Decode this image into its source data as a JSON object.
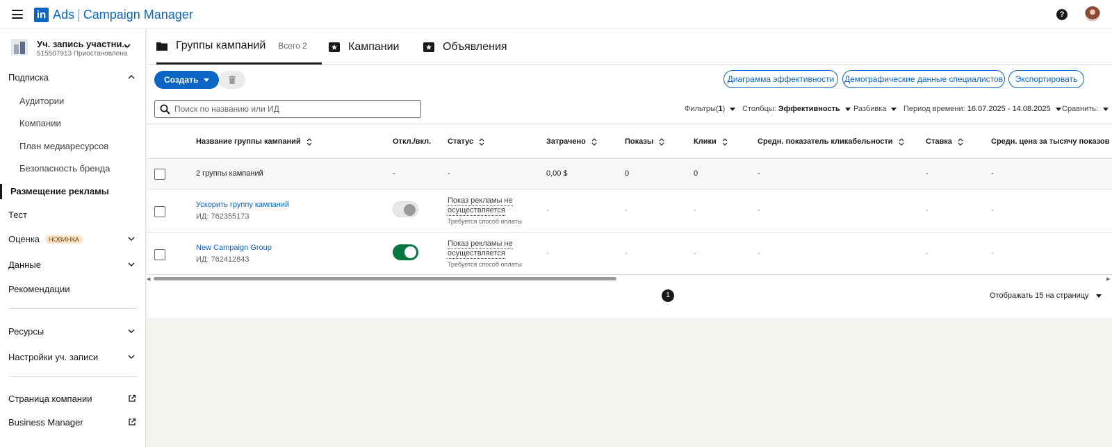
{
  "header": {
    "logo_text": "in",
    "brand_ads": "Ads",
    "brand_separator": "|",
    "brand_title": "Campaign Manager",
    "help_icon": "?"
  },
  "sidebar": {
    "account": {
      "name": "Уч. запись участни...",
      "subtitle": "515507913 Приостановлена"
    },
    "nav": {
      "subscription": "Подписка",
      "audiences": "Аудитории",
      "companies": "Компании",
      "media_plan": "План медиаресурсов",
      "brand_safety": "Безопасность бренда",
      "ad_placement": "Размещение рекламы",
      "test": "Тест",
      "evaluation": "Оценка",
      "evaluation_badge": "НОВИНКА",
      "data": "Данные",
      "recommendations": "Рекомендации",
      "resources": "Ресурсы",
      "account_settings": "Настройки уч. записи",
      "company_page": "Страница компании",
      "business_manager": "Business Manager"
    }
  },
  "tabs": {
    "groups_label": "Группы кампаний",
    "groups_count": "Всего 2",
    "campaigns_label": "Кампании",
    "ads_label": "Объявления"
  },
  "toolbar": {
    "create_label": "Создать",
    "performance_chart": "Диаграмма эффективности",
    "demographics": "Демографические данные специалистов",
    "export": "Экспортировать"
  },
  "search": {
    "placeholder": "Поиск по названию или ИД",
    "value": ""
  },
  "filters": {
    "filters_label": "Фильтры(",
    "filters_count": "1",
    "filters_close": ")",
    "columns_label": "Столбцы:",
    "columns_value": "Эффективность",
    "breakdown_label": "Разбивка",
    "period_label": "Период времени:",
    "period_value": "16.07.2025 - 14.08.2025",
    "compare_label": "Сравнить:"
  },
  "table": {
    "headers": {
      "name": "Название группы кампаний",
      "toggle": "Откл./вкл.",
      "status": "Статус",
      "spent": "Затрачено",
      "impressions": "Показы",
      "clicks": "Клики",
      "ctr": "Средн. показатель кликабельности",
      "bid": "Ставка",
      "cpm": "Средн. цена за тысячу показов"
    },
    "summary": {
      "name": "2 группы кампаний",
      "toggle": "-",
      "status": "-",
      "spent": "0,00 $",
      "impressions": "0",
      "clicks": "0",
      "ctr": "-",
      "bid": "-",
      "cpm": "-"
    },
    "rows": [
      {
        "name": "Ускорить группу кампаний",
        "id": "ИД: 762355173",
        "toggle_on": false,
        "status_line1": "Показ рекламы не",
        "status_line2": "осуществляется",
        "status_note": "Требуется способ оплаты",
        "spent": "-",
        "impressions": "-",
        "clicks": "-",
        "ctr": "-",
        "bid": "-",
        "cpm": "-"
      },
      {
        "name": "New Campaign Group",
        "id": "ИД: 762412843",
        "toggle_on": true,
        "status_line1": "Показ рекламы не",
        "status_line2": "осуществляется",
        "status_note": "Требуется способ оплаты",
        "spent": "-",
        "impressions": "-",
        "clicks": "-",
        "ctr": "-",
        "bid": "-",
        "cpm": "-"
      }
    ]
  },
  "pagination": {
    "current_page": "1",
    "per_page_label": "Отображать 15 на страницу"
  },
  "colors": {
    "accent": "#0a66c2",
    "toggle_on": "#057642",
    "badge_bg": "#fbe3c4"
  },
  "icons": [
    "menu-icon",
    "help-icon",
    "folder-icon",
    "campaign-icon",
    "ad-icon",
    "trash-icon",
    "search-icon",
    "sort-icon",
    "chevron-down-icon",
    "chevron-up-icon",
    "external-link-icon"
  ]
}
